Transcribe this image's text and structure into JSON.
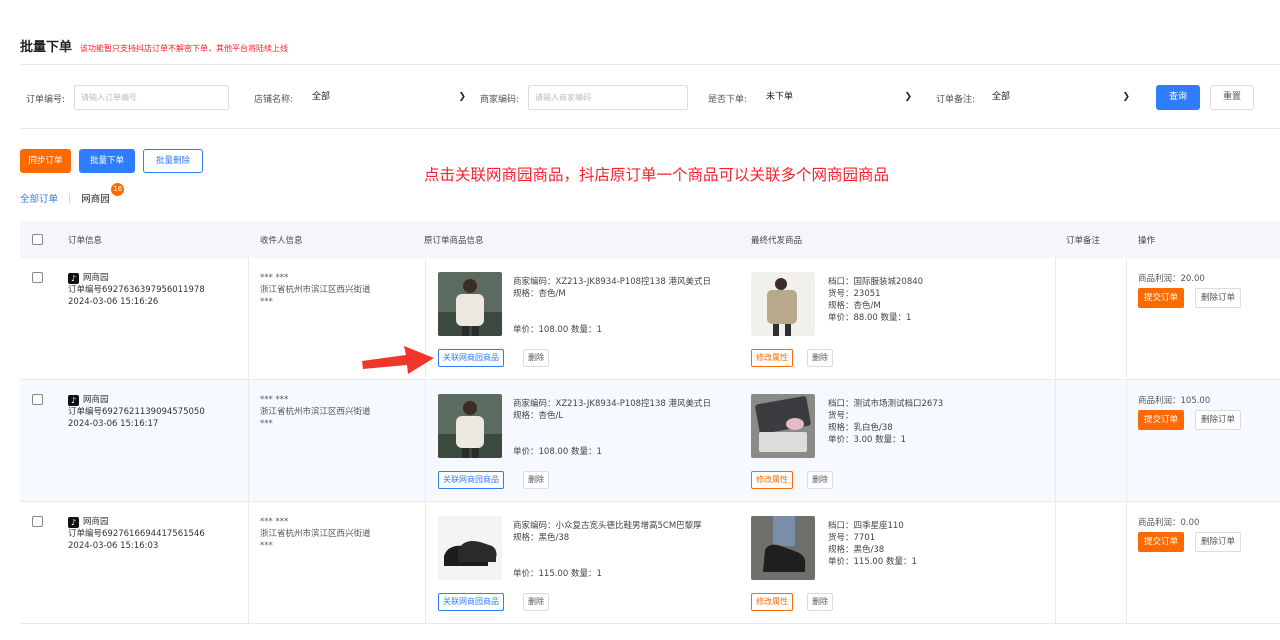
{
  "header": {
    "title": "批量下单",
    "notice": "该功能暂只支持抖店订单不解密下单，其他平台将陆续上线"
  },
  "filters": {
    "order_no_label": "订单编号:",
    "order_no_placeholder": "请输入订单编号",
    "shop_label": "店铺名称:",
    "shop_value": "全部",
    "merchant_code_label": "商家编码:",
    "merchant_code_placeholder": "请输入商家编码",
    "ordered_label": "是否下单:",
    "ordered_value": "未下单",
    "remark_label": "订单备注:",
    "remark_value": "全部",
    "query_label": "查询",
    "reset_label": "重置"
  },
  "actions": {
    "sync_label": "同步订单",
    "batch_order_label": "批量下单",
    "batch_delete_label": "批量删除"
  },
  "annotation": "点击关联网商园商品，抖店原订单一个商品可以关联多个网商园商品",
  "tabs": {
    "all": "全部订单",
    "separator": "|",
    "wsy": "网商园",
    "wsy_badge": "16"
  },
  "table": {
    "headers": {
      "order_info": "订单信息",
      "receiver": "收件人信息",
      "orig_goods": "原订单商品信息",
      "final_goods": "最终代发商品",
      "remark": "订单备注",
      "ops": "操作"
    },
    "rows": [
      {
        "shop": "网商园",
        "order_no": "订单编号6927636397956011978",
        "time": "2024-03-06 15:16:26",
        "recv_name": "*** ***",
        "recv_addr": "浙江省杭州市滨江区西兴街道",
        "recv_extra": "***",
        "orig_code": "商家编码：XZ213-JK8934-P108控138 港风美式日",
        "orig_spec": "规格：杏色/M",
        "orig_price": "单价：108.00 数量：1",
        "link_label": "关联网商园商品",
        "delete_label": "删除",
        "final_line1": "档口：国际服装城20840",
        "final_line2": "货号：23051",
        "final_line3": "规格：杏色/M",
        "final_line4": "单价：88.00 数量：1",
        "modify_label": "修改属性",
        "final_delete_label": "删除",
        "profit": "商品利润：20.00",
        "submit_label": "提交订单",
        "delete_order_label": "删除订单"
      },
      {
        "shop": "网商园",
        "order_no": "订单编号6927621139094575050",
        "time": "2024-03-06 15:16:17",
        "recv_name": "*** ***",
        "recv_addr": "浙江省杭州市滨江区西兴街道",
        "recv_extra": "***",
        "orig_code": "商家编码：XZ213-JK8934-P108控138 港风美式日",
        "orig_spec": "规格：杏色/L",
        "orig_price": "单价：108.00 数量：1",
        "link_label": "关联网商园商品",
        "delete_label": "删除",
        "final_line1": "档口：测试市场测试档口2673",
        "final_line2": "货号：",
        "final_line3": "规格：乳白色/38",
        "final_line4": "单价：3.00 数量：1",
        "modify_label": "修改属性",
        "final_delete_label": "删除",
        "profit": "商品利润：105.00",
        "submit_label": "提交订单",
        "delete_order_label": "删除订单"
      },
      {
        "shop": "网商园",
        "order_no": "订单编号6927616694417561546",
        "time": "2024-03-06 15:16:03",
        "recv_name": "*** ***",
        "recv_addr": "浙江省杭州市滨江区西兴街道",
        "recv_extra": "***",
        "orig_code": "商家编码：小众复古宽头德比鞋男增高5CM巴黎厚",
        "orig_spec": "规格：黑色/38",
        "orig_price": "单价：115.00 数量：1",
        "link_label": "关联网商园商品",
        "delete_label": "删除",
        "final_line1": "档口：四季星座110",
        "final_line2": "货号：7701",
        "final_line3": "规格：黑色/38",
        "final_line4": "单价：115.00 数量：1",
        "modify_label": "修改属性",
        "final_delete_label": "删除",
        "profit": "商品利润：0.00",
        "submit_label": "提交订单",
        "delete_order_label": "删除订单"
      }
    ]
  },
  "colors": {
    "primary": "#2f7dff",
    "orange": "#ff6a00",
    "red": "#f5222d"
  }
}
